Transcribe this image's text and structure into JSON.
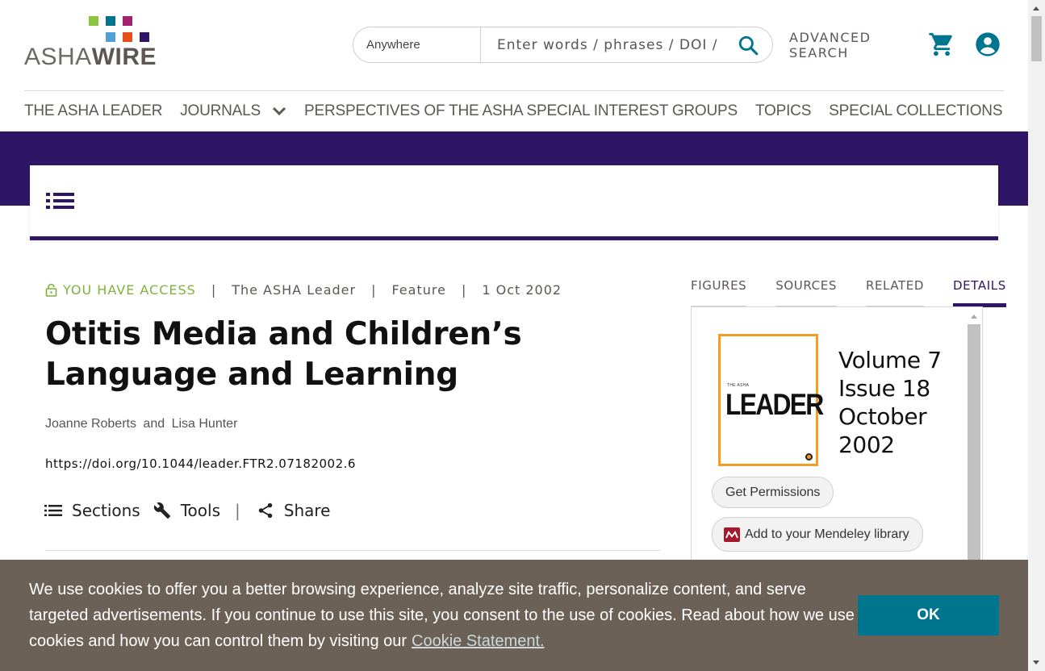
{
  "brand": {
    "logo_text_light": "ASHA",
    "logo_text_bold": "WIRE",
    "logo_colors": [
      "#8cc63f",
      "#00768e",
      "#a4216f",
      "#4f9fd8",
      "#e84e1b",
      "#2e1566"
    ]
  },
  "search": {
    "scope_label": "Anywhere",
    "placeholder": "Enter words / phrases / DOI / ISBN / keywords / authors / etc",
    "advanced_line1": "ADVANCED",
    "advanced_line2": "SEARCH"
  },
  "nav": {
    "items": [
      {
        "label": "THE ASHA LEADER"
      },
      {
        "label": "JOURNALS"
      },
      {
        "label": "PERSPECTIVES OF THE ASHA SPECIAL INTEREST GROUPS"
      },
      {
        "label": "TOPICS"
      },
      {
        "label": "SPECIAL COLLECTIONS"
      }
    ]
  },
  "article": {
    "access_label": "YOU HAVE ACCESS",
    "journal": "The ASHA Leader",
    "type": "Feature",
    "date": "1 Oct 2002",
    "title": "Otitis Media and Children’s Language and Learning",
    "author1": "Joanne Roberts",
    "author_conj": "and",
    "author2": "Lisa Hunter",
    "doi": "https://doi.org/10.1044/leader.FTR2.07182002.6",
    "tools": {
      "sections": "Sections",
      "tools": "Tools",
      "share": "Share"
    }
  },
  "sidepanel": {
    "tabs": [
      "FIGURES",
      "SOURCES",
      "RELATED",
      "DETAILS"
    ],
    "active_tab": "DETAILS",
    "cover_small": "THE ASHA",
    "cover_big": "LEADER",
    "volume": "Volume 7",
    "issue": "Issue 18",
    "month": "October",
    "year": "2002",
    "permissions_label": "Get Permissions",
    "mendeley_label": "Add to your Mendeley library"
  },
  "cookie": {
    "message": "We use cookies to offer you a better browsing experience, analyze site traffic, personalize content, and serve targeted advertisements. If you continue to use this site, you consent to the use of cookies. Read about how we use cookies and how you can control them by visiting our",
    "link_label": "Cookie Statement.",
    "ok_label": "OK"
  }
}
